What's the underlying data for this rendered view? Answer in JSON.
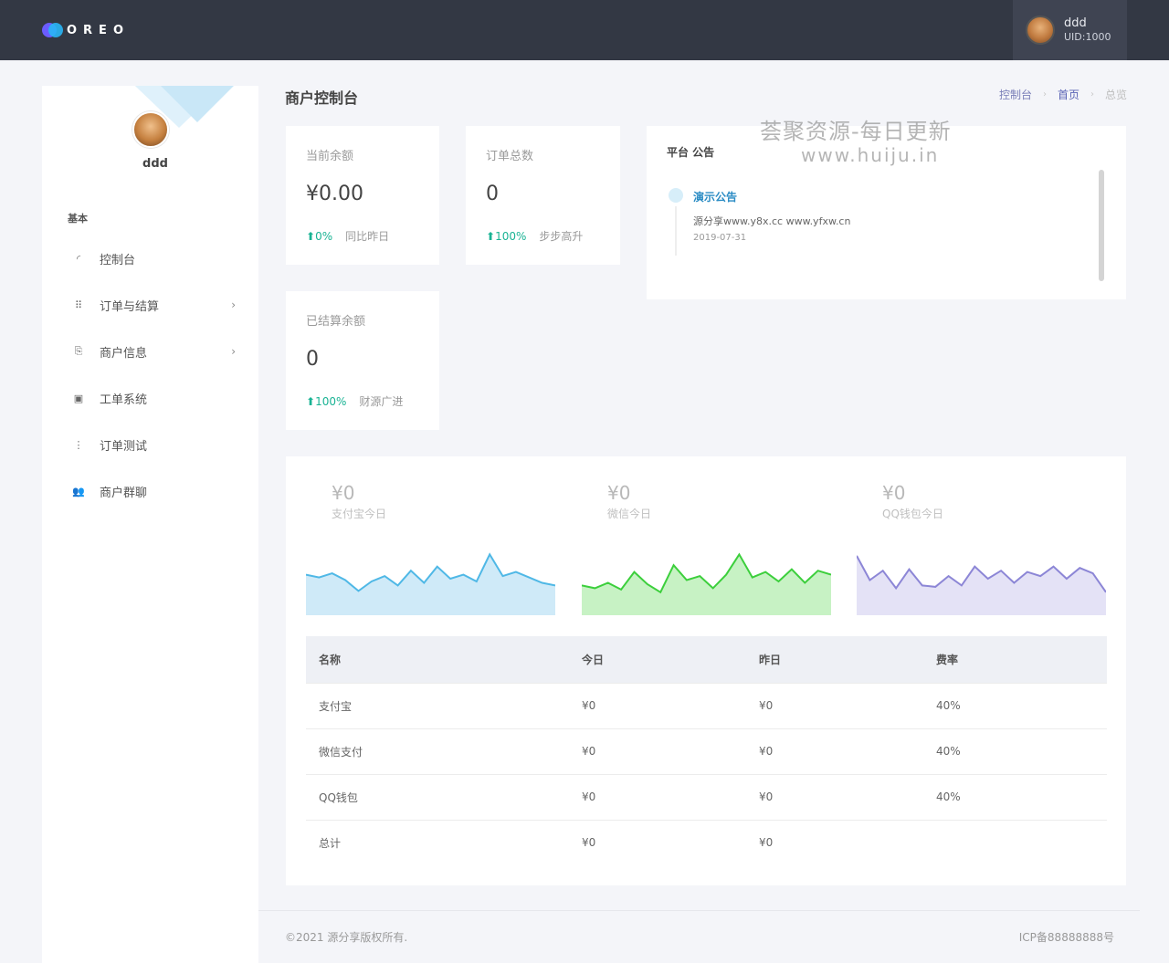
{
  "brand": {
    "logo_text": "OREO"
  },
  "topbar": {
    "username": "ddd",
    "uid": "UID:1000"
  },
  "sidebar": {
    "username": "ddd",
    "section": "基本",
    "items": [
      {
        "label": "控制台",
        "icon": "gauge-icon",
        "glyph": "◜",
        "has_children": false
      },
      {
        "label": "订单与结算",
        "icon": "grid-icon",
        "glyph": "⠿",
        "has_children": true
      },
      {
        "label": "商户信息",
        "icon": "copy-icon",
        "glyph": "⎘",
        "has_children": true
      },
      {
        "label": "工单系统",
        "icon": "ticket-icon",
        "glyph": "▣",
        "has_children": false
      },
      {
        "label": "订单测试",
        "icon": "test-icon",
        "glyph": "⋮",
        "has_children": false
      },
      {
        "label": "商户群聊",
        "icon": "group-icon",
        "glyph": "👥",
        "has_children": false
      }
    ],
    "chevron": "›"
  },
  "header": {
    "title": "商户控制台"
  },
  "breadcrumb": {
    "items": [
      "控制台",
      "首页",
      "总览"
    ],
    "sep": "›"
  },
  "stats": [
    {
      "label": "当前余额",
      "value": "¥0.00",
      "arrow": "⬆",
      "pct": "0%",
      "note": "同比昨日"
    },
    {
      "label": "订单总数",
      "value": "0",
      "arrow": "⬆",
      "pct": "100%",
      "note": "步步高升"
    },
    {
      "label": "已结算余额",
      "value": "0",
      "arrow": "⬆",
      "pct": "100%",
      "note": "财源广进"
    }
  ],
  "notice": {
    "title": "平台 公告",
    "item_title": "演示公告",
    "item_body": "源分享www.y8x.cc www.yfxw.cn",
    "item_date": "2019-07-31"
  },
  "watermark": {
    "line1": "荟聚资源-每日更新",
    "line2": "www.huiju.in"
  },
  "payments": [
    {
      "amount": "¥0",
      "label": "支付宝今日",
      "color": "#4fb8e6",
      "fill": "#cfeaf8",
      "values": [
        30,
        28,
        31,
        26,
        18,
        25,
        29,
        22,
        33,
        24,
        36,
        27,
        30,
        25,
        45,
        29,
        32,
        28,
        24,
        22
      ]
    },
    {
      "amount": "¥0",
      "label": "微信今日",
      "color": "#3ccf3c",
      "fill": "#c7f2c4",
      "values": [
        22,
        20,
        24,
        19,
        32,
        23,
        17,
        37,
        26,
        29,
        20,
        30,
        45,
        28,
        32,
        25,
        34,
        24,
        33,
        30
      ]
    },
    {
      "amount": "¥0",
      "label": "QQ钱包今日",
      "color": "#8c86d6",
      "fill": "#e4e2f6",
      "values": [
        44,
        26,
        33,
        20,
        34,
        22,
        21,
        29,
        22,
        36,
        27,
        33,
        24,
        32,
        29,
        36,
        27,
        35,
        31,
        17
      ]
    }
  ],
  "table": {
    "headers": [
      "名称",
      "今日",
      "昨日",
      "费率"
    ],
    "rows": [
      [
        "支付宝",
        "¥0",
        "¥0",
        "40%"
      ],
      [
        "微信支付",
        "¥0",
        "¥0",
        "40%"
      ],
      [
        "QQ钱包",
        "¥0",
        "¥0",
        "40%"
      ],
      [
        "总计",
        "¥0",
        "¥0",
        ""
      ]
    ]
  },
  "footer": {
    "copyright": "©2021 源分享版权所有.",
    "icp": "ICP备88888888号"
  }
}
